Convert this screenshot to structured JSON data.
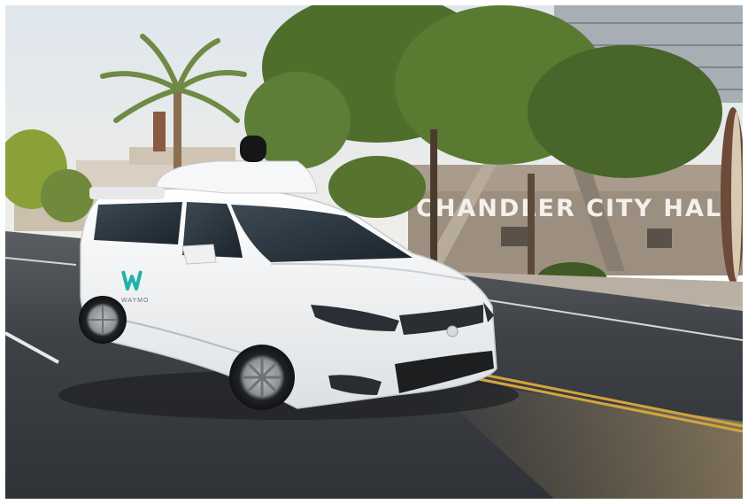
{
  "photo": {
    "sign_text": "CHANDLER CITY HALL",
    "vehicle_logo_text": "WAYMO",
    "colors": {
      "sky": "#e9eef2",
      "road": "#3a3d42",
      "vehicle_body": "#f3f4f5",
      "foliage": "#4f6e2c",
      "building_stone": "#9c8f80",
      "logo_teal": "#1fb3a8"
    }
  }
}
